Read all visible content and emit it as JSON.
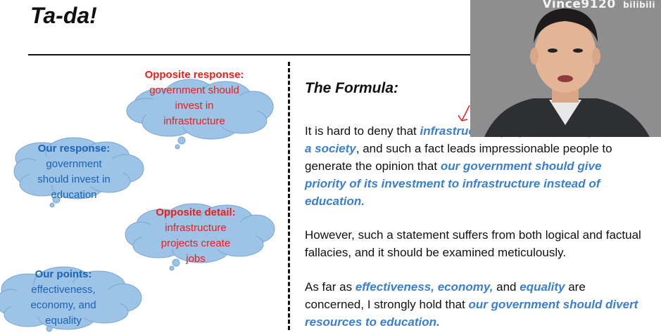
{
  "title": "Ta-da!",
  "left_clouds": {
    "opposite_response": {
      "heading": "Opposite response:",
      "body": "government should invest in infrastructure"
    },
    "our_response": {
      "heading": "Our response:",
      "body": "government should invest in education"
    },
    "opposite_detail": {
      "heading": "Opposite detail:",
      "body": "infrastructure projects create jobs"
    },
    "our_points": {
      "heading": "Our points:",
      "body": "effectiveness, economy, and equality"
    }
  },
  "formula": {
    "heading": "The Formula:",
    "p1": {
      "t1": "It is hard to deny that ",
      "h1": "infrastructure projects create jobs for a society",
      "t2": ", and such a fact leads impressionable people to generate the opinion that ",
      "h2": "our government should give priority of its investment to infrastructure instead of education."
    },
    "p2": "However, such a statement suffers from both logical and factual fallacies, and it should be examined meticulously.",
    "p3": {
      "t1": "As far as ",
      "h1": "effectiveness",
      "c1": ", ",
      "h2": "economy,",
      "t2": " and ",
      "h3": "equality",
      "t3": " are concerned, I strongly hold that ",
      "h4": "our government should divert resources to education."
    }
  },
  "webcam": {
    "watermark": "Vince9120",
    "logo": "bilibili"
  }
}
